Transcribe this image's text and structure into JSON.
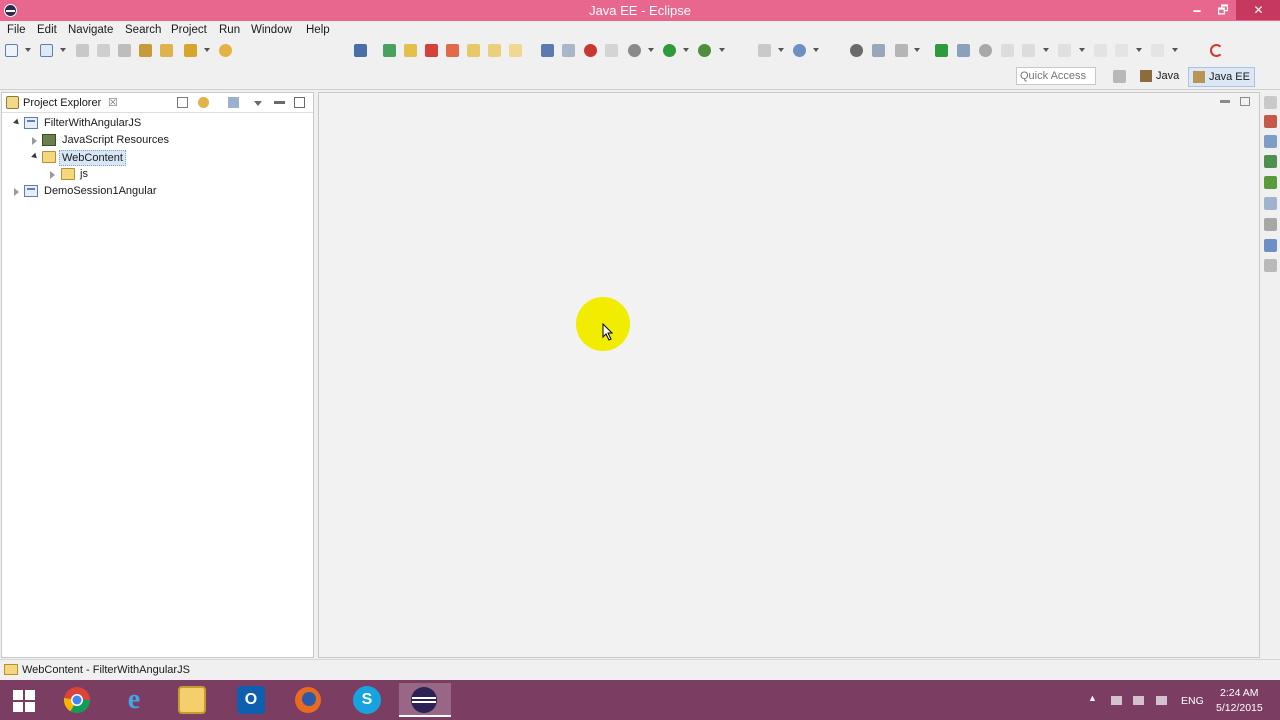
{
  "window": {
    "title": "Java EE - Eclipse",
    "minimize": "🗕",
    "restore": "🗗",
    "close": "✕"
  },
  "menu": [
    "File",
    "Edit",
    "Navigate",
    "Search",
    "Project",
    "Run",
    "Window",
    "Help"
  ],
  "quick_access": {
    "placeholder": "Quick Access"
  },
  "perspectives": [
    {
      "label": "Java",
      "icon": "java-perspective-icon",
      "active": false
    },
    {
      "label": "Java EE",
      "icon": "javaee-perspective-icon",
      "active": true
    }
  ],
  "explorer": {
    "title": "Project Explorer",
    "close_glyph": "☒",
    "tree": [
      {
        "label": "FilterWithAngularJS",
        "icon": "project-icon",
        "expanded": true,
        "depth": 0
      },
      {
        "label": "JavaScript Resources",
        "icon": "javascript-resources-icon",
        "expanded": false,
        "depth": 1
      },
      {
        "label": "WebContent",
        "icon": "folder-icon",
        "expanded": true,
        "depth": 1,
        "selected": true
      },
      {
        "label": "js",
        "icon": "folder-icon",
        "expanded": false,
        "depth": 2
      },
      {
        "label": "DemoSession1Angular",
        "icon": "project-icon",
        "expanded": false,
        "depth": 0
      }
    ]
  },
  "status": {
    "text": "WebContent - FilterWithAngularJS"
  },
  "taskbar": {
    "apps": [
      {
        "name": "start-button",
        "glyph": "⊞"
      },
      {
        "name": "chrome",
        "glyph": "●"
      },
      {
        "name": "internet-explorer",
        "glyph": "e"
      },
      {
        "name": "file-explorer",
        "glyph": "▭"
      },
      {
        "name": "outlook",
        "glyph": "O"
      },
      {
        "name": "firefox",
        "glyph": "●"
      },
      {
        "name": "skype",
        "glyph": "S"
      },
      {
        "name": "eclipse",
        "glyph": "◉",
        "active": true
      }
    ],
    "language": "ENG",
    "time": "2:24 AM",
    "date": "5/12/2015"
  },
  "colors": {
    "titlebar": "#e8678f",
    "taskbar": "#7c3d63",
    "cursor_highlight": "#f2ec00",
    "selection": "#d9e6f5"
  }
}
